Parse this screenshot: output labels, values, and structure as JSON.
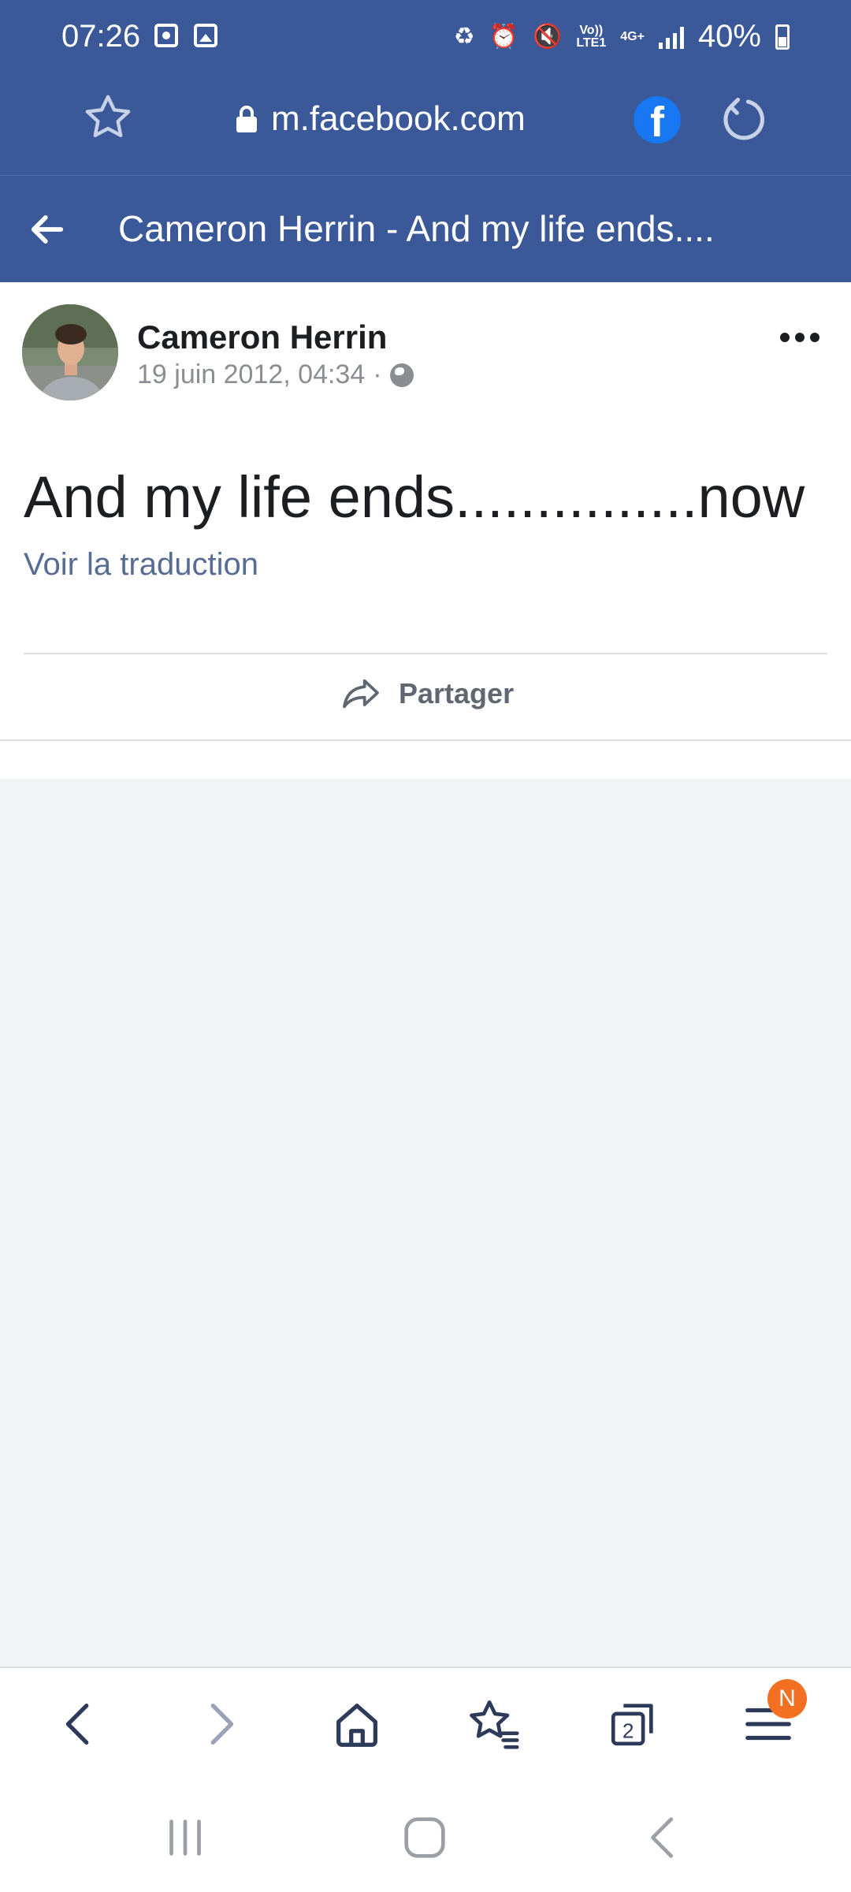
{
  "status_bar": {
    "time": "07:26",
    "network_top": "Vo))",
    "network_bottom": "LTE1",
    "data_type": "4G+",
    "battery": "40%"
  },
  "browser": {
    "url": "m.facebook.com",
    "fb_letter": "f"
  },
  "page_header": {
    "title": "Cameron Herrin - And my life ends...."
  },
  "post": {
    "author": "Cameron Herrin",
    "date": "19 juin 2012, 04:34",
    "separator": "·",
    "text": "And my life ends...............now",
    "see_translation": "Voir la traduction",
    "share_label": "Partager"
  },
  "toolbar": {
    "tabs_count": "2",
    "menu_badge": "N"
  },
  "colors": {
    "brand": "#3b5998",
    "facebook_blue": "#1877f2",
    "link": "#576b95",
    "badge": "#f36f21"
  },
  "icons": [
    "star-icon",
    "lock-icon",
    "facebook-icon",
    "reload-icon",
    "back-arrow-icon",
    "globe-icon",
    "more-icon",
    "share-icon",
    "home-icon",
    "bookmarks-icon",
    "tabs-icon",
    "menu-icon"
  ]
}
